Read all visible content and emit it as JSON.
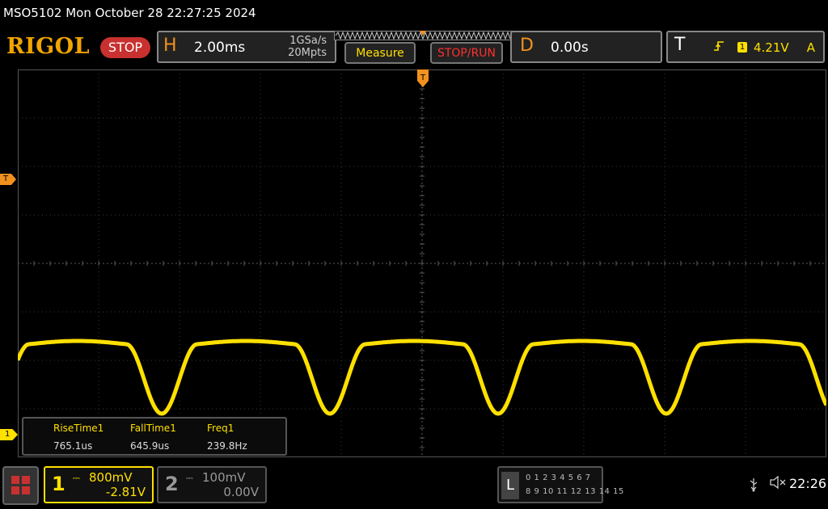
{
  "window": {
    "title": "MSO5102  Mon October 28 22:27:25 2024"
  },
  "brand": {
    "logo": "RIGOL",
    "status": "STOP"
  },
  "horizontal": {
    "letter": "H",
    "timebase": "2.00ms",
    "sample_rate": "1GSa/s",
    "memory_depth": "20Mpts"
  },
  "buttons": {
    "measure": "Measure",
    "stop_run": "STOP/RUN"
  },
  "delay": {
    "letter": "D",
    "value": "0.00s"
  },
  "trigger": {
    "letter": "T",
    "edge_icon": "rising-edge-icon",
    "source": "1",
    "level": "4.21V",
    "mode": "A"
  },
  "markers": {
    "trigger_level": "T",
    "ch1_ground": "1"
  },
  "measurements": [
    {
      "label": "RiseTime1",
      "value": "765.1us"
    },
    {
      "label": "FallTime1",
      "value": "645.9us"
    },
    {
      "label": "Freq1",
      "value": "239.8Hz"
    }
  ],
  "channels": [
    {
      "number": "1",
      "scale": "800mV",
      "offset": "-2.81V",
      "active": true,
      "color": "#ffe000"
    },
    {
      "number": "2",
      "scale": "100mV",
      "offset": "0.00V",
      "active": false,
      "color": "#999999"
    }
  ],
  "logic": {
    "label": "L",
    "row1": "0 1 2 3  4 5 6 7",
    "row2": "8 9 10 11 12 13 14 15"
  },
  "status_bar": {
    "usb_icon": "usb-icon",
    "sound_icon": "speaker-muted-icon",
    "time": "22:26"
  },
  "colors": {
    "ch1": "#ffe000",
    "accent_orange": "#f2911e",
    "stop_red": "#c8312f"
  }
}
